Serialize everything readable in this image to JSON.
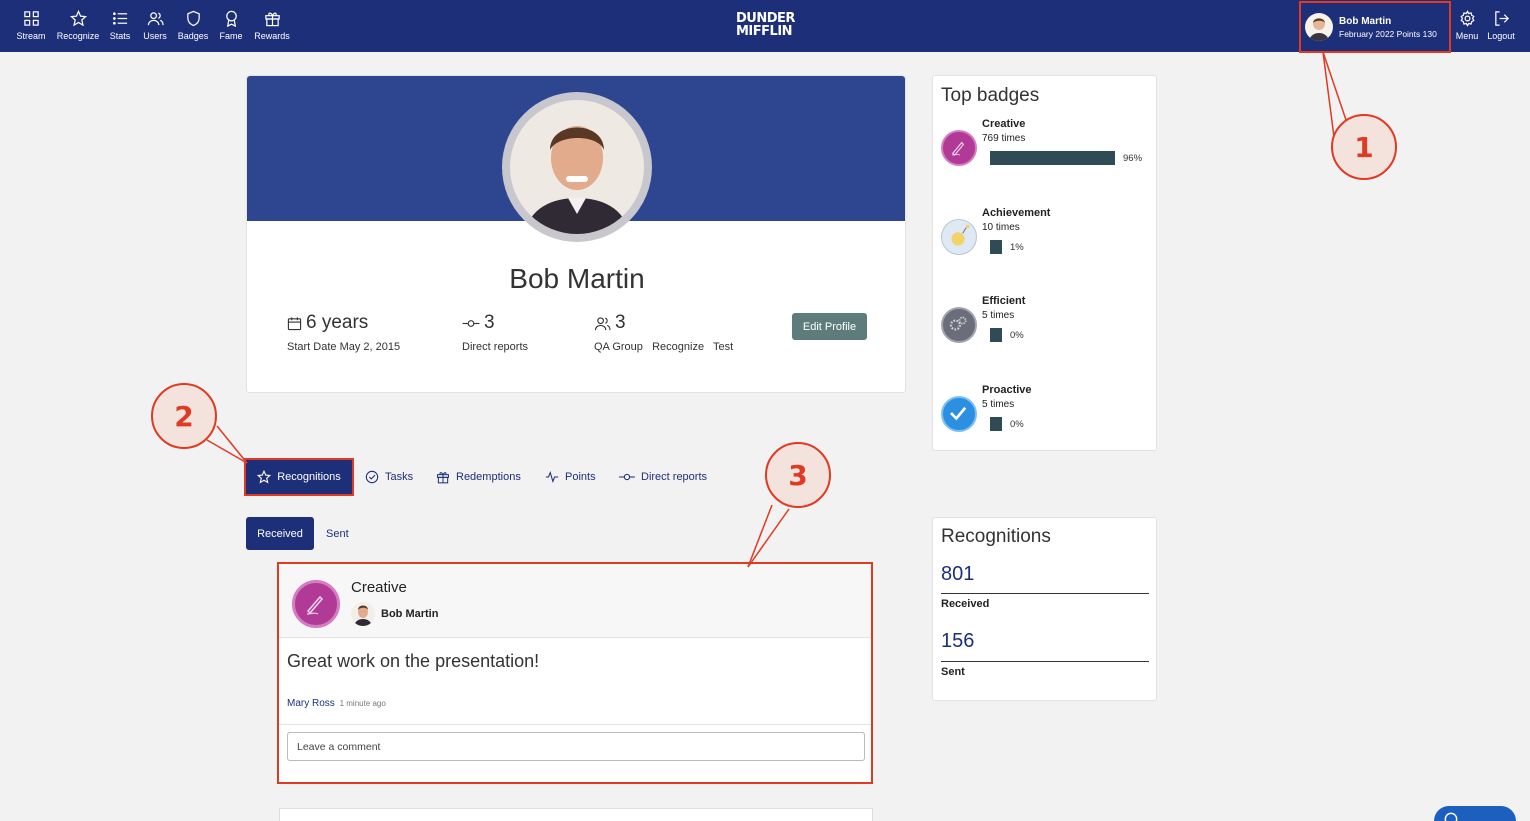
{
  "nav": {
    "items": [
      {
        "label": "Stream",
        "icon": "grid-icon"
      },
      {
        "label": "Recognize",
        "icon": "star-icon"
      },
      {
        "label": "Stats",
        "icon": "list-icon"
      },
      {
        "label": "Users",
        "icon": "users-icon"
      },
      {
        "label": "Badges",
        "icon": "shield-icon"
      },
      {
        "label": "Fame",
        "icon": "award-icon"
      },
      {
        "label": "Rewards",
        "icon": "gift-icon"
      }
    ],
    "logo_line1": "DUNDER",
    "logo_line2": "MIFFLIN",
    "user_name": "Bob Martin",
    "user_sub": "February 2022 Points 130",
    "menu_label": "Menu",
    "logout_label": "Logout"
  },
  "profile": {
    "name": "Bob Martin",
    "tenure": "6 years",
    "start_date": "Start Date May 2, 2015",
    "direct_reports_count": "3",
    "direct_reports_label": "Direct reports",
    "groups_count": "3",
    "groups_label": "QA Group   Recognize   Test",
    "edit_button": "Edit Profile"
  },
  "top_badges": {
    "title": "Top badges",
    "items": [
      {
        "name": "Creative",
        "times": "769 times",
        "percent": "96%",
        "fraction": 0.96
      },
      {
        "name": "Achievement",
        "times": "10 times",
        "percent": "1%",
        "fraction": 0.01
      },
      {
        "name": "Efficient",
        "times": "5 times",
        "percent": "0%",
        "fraction": 0.0
      },
      {
        "name": "Proactive",
        "times": "5 times",
        "percent": "0%",
        "fraction": 0.0
      }
    ]
  },
  "tabs": {
    "items": [
      {
        "label": "Recognitions",
        "icon": "star-icon",
        "active": true
      },
      {
        "label": "Tasks",
        "icon": "check-circle-icon"
      },
      {
        "label": "Redemptions",
        "icon": "gift-icon"
      },
      {
        "label": "Points",
        "icon": "activity-icon"
      },
      {
        "label": "Direct reports",
        "icon": "commit-icon"
      }
    ]
  },
  "subtabs": {
    "received": "Received",
    "sent": "Sent"
  },
  "recognition_post": {
    "badge": "Creative",
    "recipient": "Bob Martin",
    "message": "Great work on the presentation!",
    "author": "Mary Ross",
    "time_ago": "1 minute ago",
    "comment_placeholder": "Leave a comment"
  },
  "recognitions_summary": {
    "title": "Recognitions",
    "received_count": "801",
    "received_label": "Received",
    "sent_count": "156",
    "sent_label": "Sent"
  },
  "callouts": [
    "1",
    "2",
    "3"
  ],
  "colors": {
    "nav_bg": "#1e2f7a",
    "accent": "#e03a22",
    "bar": "#2e4b56",
    "edit_button": "#5f7c7c"
  }
}
